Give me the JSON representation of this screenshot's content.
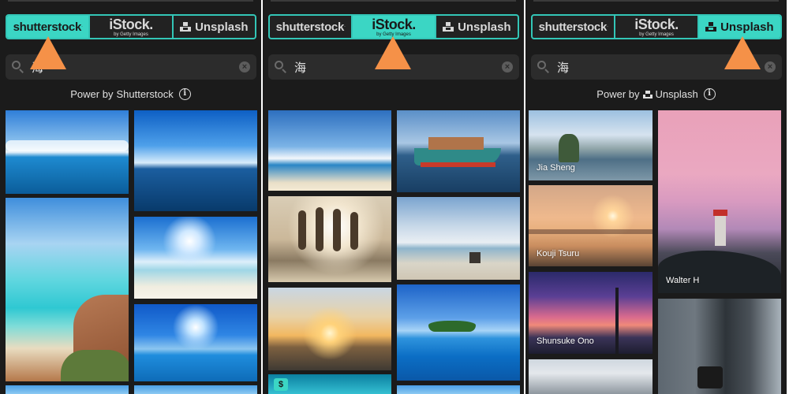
{
  "tabs": {
    "shutterstock": "shutterstock",
    "istock_main": "iStock.",
    "istock_sub": "by Getty Images",
    "unsplash": "Unsplash"
  },
  "search": {
    "query": "海"
  },
  "attribution": {
    "prefix": "Power by",
    "shutterstock": "Shutterstock",
    "unsplash": "Unsplash"
  },
  "credits": [
    "Jia Sheng",
    "Kouji Tsuru",
    "Walter H",
    "Shunsuke Ono"
  ],
  "badge": {
    "paid": "$"
  },
  "colors": {
    "accent": "#3bd6c4",
    "arrow": "#f59148",
    "panel_bg": "#1b1b1b"
  },
  "icons": [
    "search-icon",
    "clear-icon",
    "info-icon",
    "unsplash-logo-icon",
    "arrow-indicator-icon"
  ]
}
